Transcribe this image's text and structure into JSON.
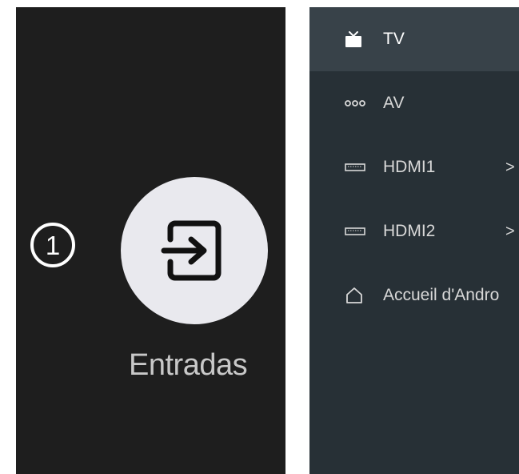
{
  "left": {
    "step_number": "1",
    "inputs_label": "Entradas",
    "inputs_icon": "input-icon"
  },
  "right": {
    "menu": [
      {
        "label": "TV",
        "icon": "tv-icon",
        "selected": true
      },
      {
        "label": "AV",
        "icon": "av-icon"
      },
      {
        "label": "HDMI1",
        "icon": "hdmi-icon",
        "arrow": ">"
      },
      {
        "label": "HDMI2",
        "icon": "hdmi-icon",
        "arrow": ">"
      },
      {
        "label": "Accueil d'Andro",
        "icon": "home-icon"
      }
    ]
  },
  "colors": {
    "left_bg": "#1e1e1e",
    "right_bg": "#273036",
    "selected_row": "#384249",
    "circle": "#e9e9ee"
  }
}
